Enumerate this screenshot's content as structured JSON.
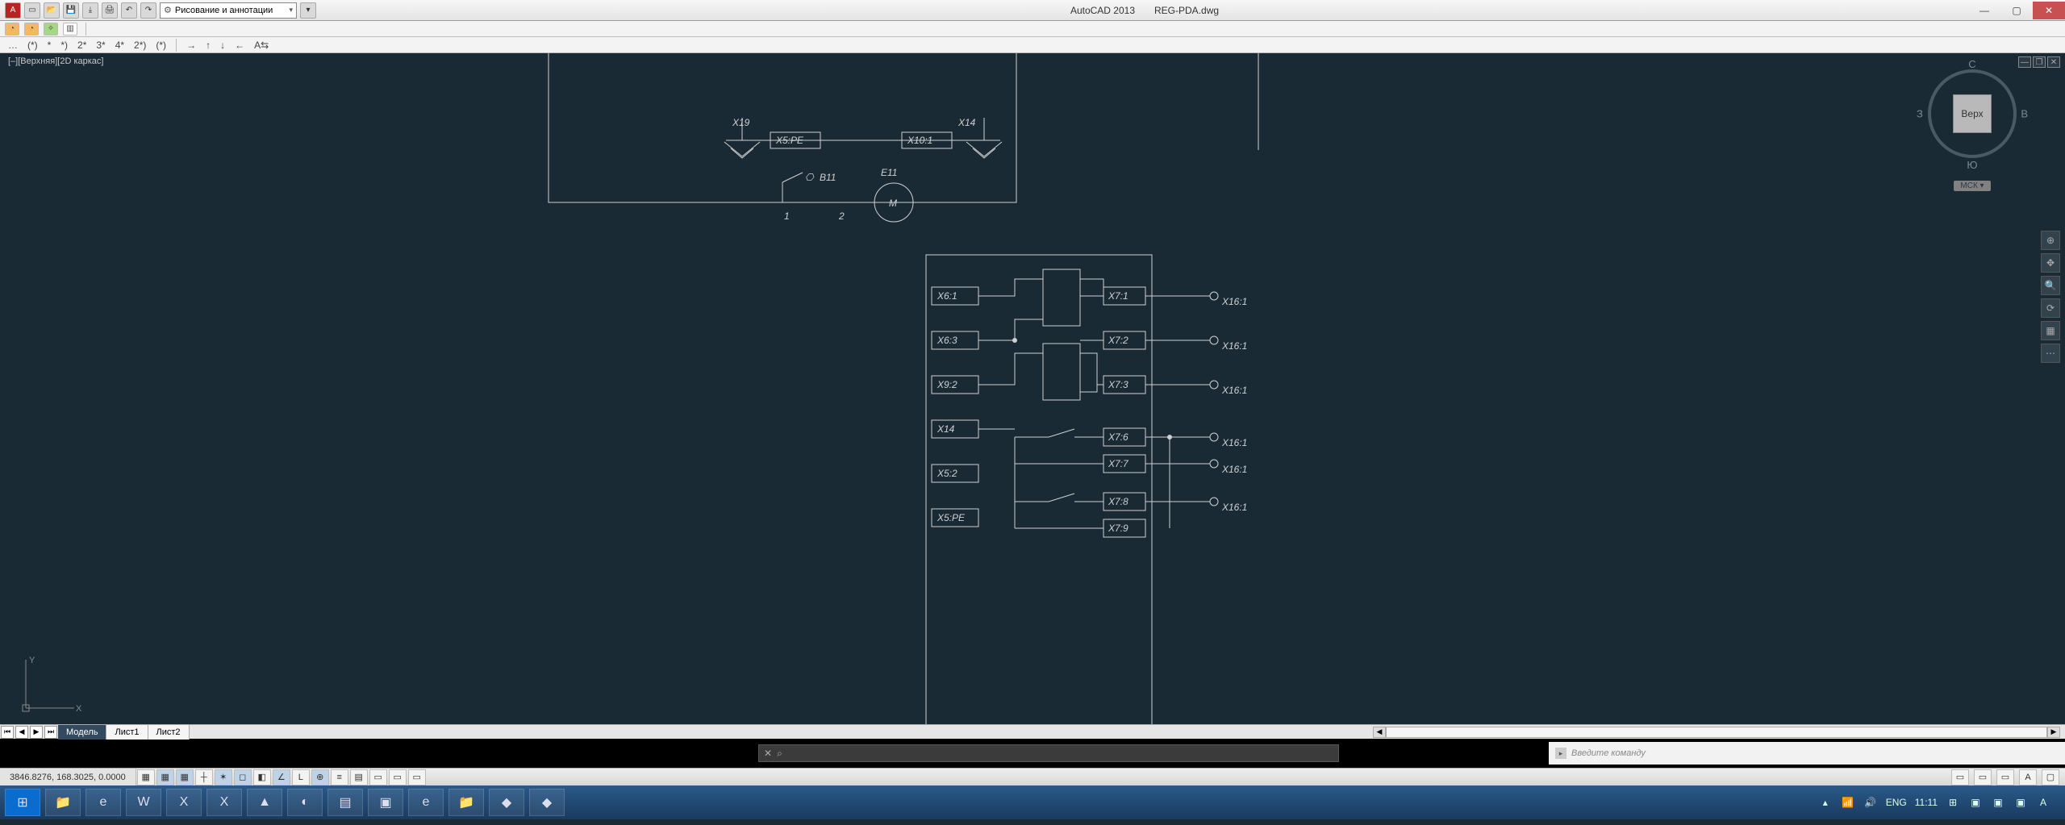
{
  "title": {
    "app": "AutoCAD 2013",
    "file": "REG-PDA.dwg"
  },
  "workspace": {
    "label": "Рисование и аннотации"
  },
  "toolbar3": [
    "…",
    "(*)",
    "*",
    "*)",
    "2*",
    "3*",
    "4*",
    "2*)",
    "(*)",
    "→",
    "↑",
    "↓",
    "←",
    "A⇆"
  ],
  "viewport": {
    "label": "[–][Верхняя][2D каркас]",
    "viewcube": {
      "face": "Верх",
      "n": "С",
      "s": "Ю",
      "e": "В",
      "w": "З",
      "cs": "МСК ▾"
    }
  },
  "schematic": {
    "top": {
      "labels": {
        "x19": "X19",
        "x5pe": "X5:PE",
        "x10_1": "X10:1",
        "x14": "X14",
        "b11": "B11",
        "e11": "E11",
        "m": "M",
        "n1": "1",
        "n2": "2",
        "sw": "⎔"
      }
    },
    "block": {
      "left": [
        "X6:1",
        "X6:3",
        "X9:2",
        "X14",
        "X5:2",
        "X5:PE"
      ],
      "right": [
        "X7:1",
        "X7:2",
        "X7:3",
        "X7:6",
        "X7:7",
        "X7:8",
        "X7:9"
      ],
      "ext": [
        "X16:1",
        "X16:1",
        "X16:1",
        "X16:1",
        "X16:1",
        "X16:1"
      ]
    }
  },
  "ucs": {
    "x": "X",
    "y": "Y"
  },
  "tabs": {
    "model": "Модель",
    "l1": "Лист1",
    "l2": "Лист2"
  },
  "command": {
    "placeholder": "Введите команду"
  },
  "status": {
    "coords": "3846.8276, 168.3025, 0.0000"
  },
  "tray": {
    "lang": "ENG",
    "time": "11:11"
  }
}
